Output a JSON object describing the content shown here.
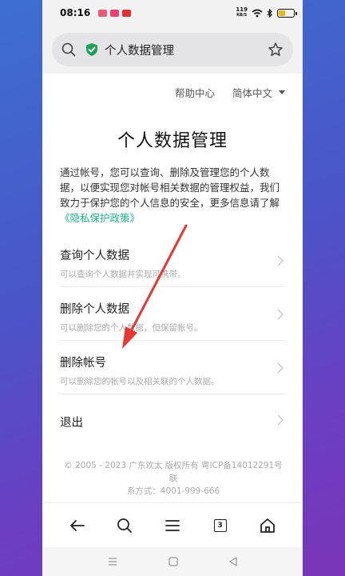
{
  "status": {
    "time": "08:16",
    "net_speed_top": "119",
    "net_speed_bottom": "KB/S",
    "colors": {
      "app1": "#e85a7a",
      "app2": "#e84070",
      "app3": "#e03030",
      "battery": "#e8b820"
    }
  },
  "urlbar": {
    "title": "个人数据管理",
    "icons": [
      "search-icon",
      "shield-check-icon",
      "star-icon"
    ],
    "shield_color": "#22a05a"
  },
  "toplinks": {
    "help": "帮助中心",
    "language": "简体中文"
  },
  "page": {
    "title": "个人数据管理",
    "description": "通过帐号，您可以查询、删除及管理您的个人数据，以便实现您对帐号相关数据的管理权益，我们致力于保护您的个人信息的安全，更多信息请了解",
    "privacy_link": "《隐私保护政策》"
  },
  "menu": {
    "items": [
      {
        "label": "查询个人数据",
        "sub": "可以查询个人数据并实现可携带。"
      },
      {
        "label": "删除个人数据",
        "sub": "可以删除您的个人数据，但保留帐号。"
      },
      {
        "label": "删除帐号",
        "sub": "可以删除您的帐号以及相关联的个人数据。"
      },
      {
        "label": "退出"
      }
    ]
  },
  "footer": {
    "line1": "© 2005 - 2023 广东欢太 版权所有 粤ICP备14012291号 联",
    "line2": "系方式：4001-999-666"
  },
  "toolbar": {
    "tab_count": "3",
    "icons": [
      "back-arrow-icon",
      "search-icon",
      "menu-icon",
      "tabs-icon",
      "home-icon"
    ]
  },
  "annotation": {
    "arrow_color": "#e53935"
  },
  "accent": {
    "link": "#1cae8d"
  }
}
